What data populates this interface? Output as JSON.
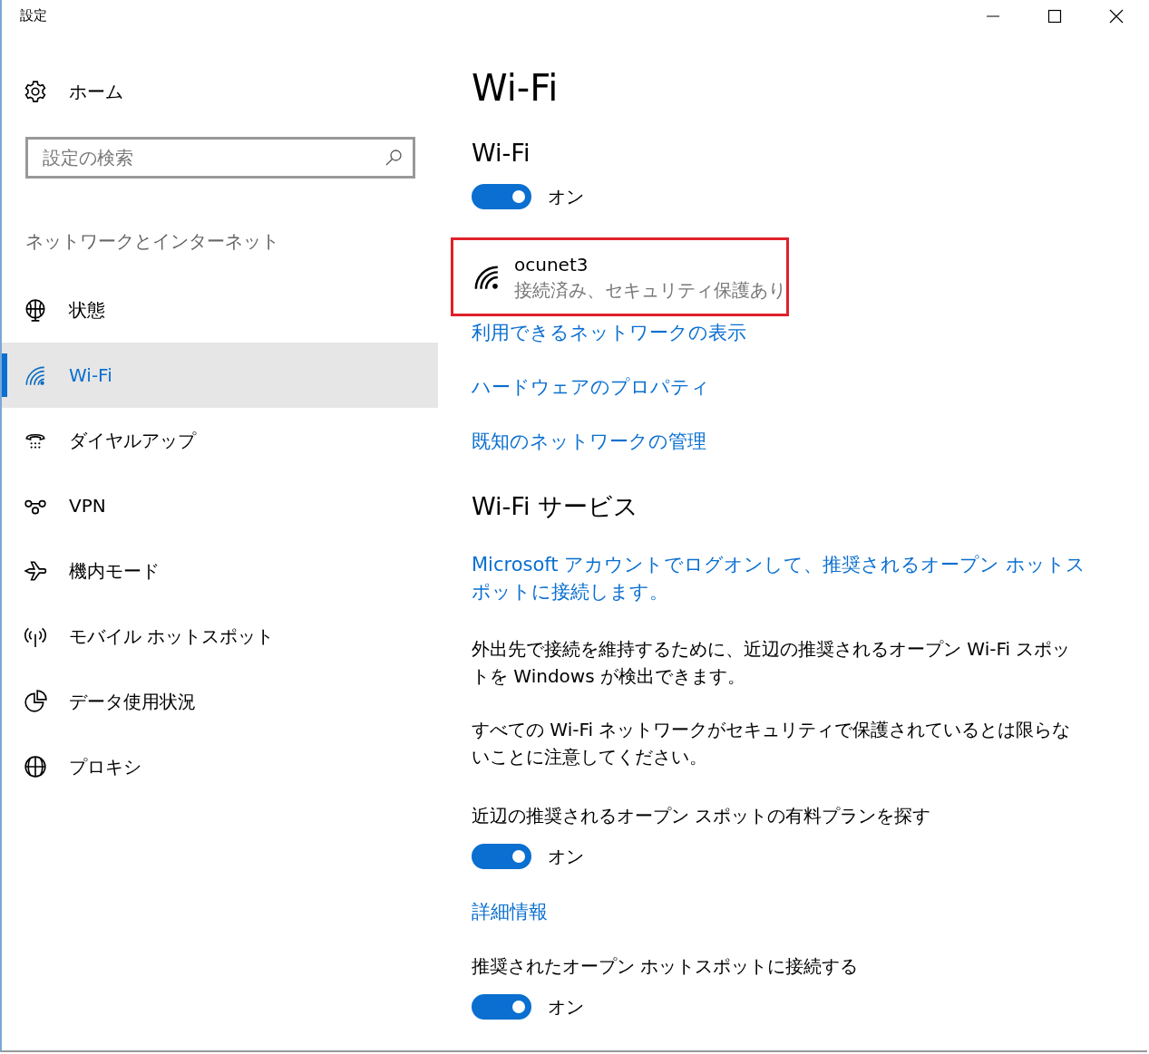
{
  "window": {
    "title": "設定"
  },
  "sidebar": {
    "home": {
      "label": "ホーム"
    },
    "search": {
      "placeholder": "設定の検索"
    },
    "section_title": "ネットワークとインターネット",
    "items": [
      {
        "kind": "status",
        "label": "状態",
        "selected": false
      },
      {
        "kind": "wifi",
        "label": "Wi-Fi",
        "selected": true
      },
      {
        "kind": "dialup",
        "label": "ダイヤルアップ",
        "selected": false
      },
      {
        "kind": "vpn",
        "label": "VPN",
        "selected": false
      },
      {
        "kind": "airplane",
        "label": "機内モード",
        "selected": false
      },
      {
        "kind": "hotspot",
        "label": "モバイル ホットスポット",
        "selected": false
      },
      {
        "kind": "data",
        "label": "データ使用状況",
        "selected": false
      },
      {
        "kind": "proxy",
        "label": "プロキシ",
        "selected": false
      }
    ]
  },
  "main": {
    "title": "Wi-Fi",
    "blocks": [
      {
        "kind": "heading",
        "text": "Wi-Fi"
      },
      {
        "kind": "toggle",
        "on": true,
        "text": "オン"
      },
      {
        "kind": "network",
        "name": "ocunet3",
        "status": "接続済み、セキュリティ保護あり",
        "highlighted": true
      },
      {
        "kind": "link",
        "text": "利用できるネットワークの表示"
      },
      {
        "kind": "link",
        "text": "ハードウェアのプロパティ"
      },
      {
        "kind": "link",
        "text": "既知のネットワークの管理"
      },
      {
        "kind": "heading",
        "text": "Wi-Fi サービス"
      },
      {
        "kind": "link",
        "text": "Microsoft アカウントでログオンして、推奨されるオープン ホットスポットに接続します。"
      },
      {
        "kind": "paragraph",
        "text": "外出先で接続を維持するために、近辺の推奨されるオープン Wi-Fi スポットを Windows が検出できます。"
      },
      {
        "kind": "paragraph",
        "text": "すべての Wi-Fi ネットワークがセキュリティで保護されているとは限らないことに注意してください。"
      },
      {
        "kind": "label",
        "text": "近辺の推奨されるオープン スポットの有料プランを探す"
      },
      {
        "kind": "toggle",
        "on": true,
        "text": "オン"
      },
      {
        "kind": "link",
        "text": "詳細情報"
      },
      {
        "kind": "label",
        "text": "推奨されたオープン ホットスポットに接続する"
      },
      {
        "kind": "toggle",
        "on": true,
        "text": "オン"
      }
    ]
  }
}
